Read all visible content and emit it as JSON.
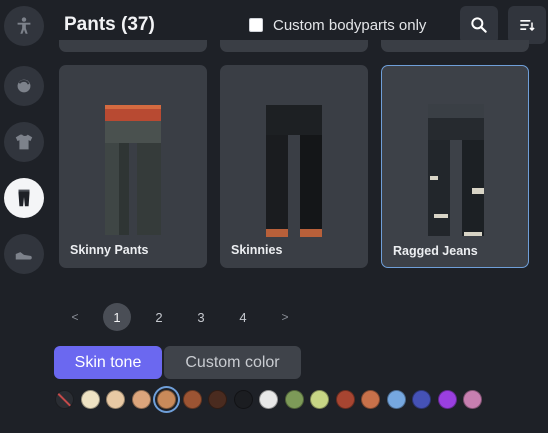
{
  "header": {
    "title": "Pants (37)",
    "custom_filter_label": "Custom bodyparts only",
    "custom_filter_checked": false
  },
  "sidebar": {
    "items": [
      {
        "name": "body",
        "icon": "body-icon"
      },
      {
        "name": "head",
        "icon": "head-icon"
      },
      {
        "name": "shirt",
        "icon": "shirt-icon"
      },
      {
        "name": "pants",
        "icon": "pants-icon",
        "active": true
      },
      {
        "name": "shoes",
        "icon": "shoe-icon"
      }
    ]
  },
  "items": [
    {
      "label": "Skinny Pants",
      "selected": false,
      "colors": {
        "leg": "#3f4645",
        "band": "#b84a32"
      }
    },
    {
      "label": "Skinnies",
      "selected": false,
      "colors": {
        "leg": "#1a1c1f",
        "cuff": "#b8603a"
      }
    },
    {
      "label": "Ragged Jeans",
      "selected": true,
      "colors": {
        "leg": "#22262b",
        "patch": "#d8d4c6"
      }
    }
  ],
  "pagination": {
    "prev": "<",
    "pages": [
      "1",
      "2",
      "3",
      "4"
    ],
    "current": "1",
    "next": ">"
  },
  "tone_tabs": {
    "skin": "Skin tone",
    "custom": "Custom color",
    "active": "skin"
  },
  "swatches": [
    "none",
    "#efe3c4",
    "#e8c9a4",
    "#dca57c",
    "#c98a5a",
    "#9c5433",
    "#4a2b1f",
    "#1b1d21",
    "#e8e8e8",
    "#7d9a58",
    "#c7d585",
    "#a74531",
    "#c8714a",
    "#76a8e0",
    "#4552b6",
    "#9a3fe0",
    "#c77fb0"
  ],
  "selected_swatch": 4,
  "colors": {
    "accent": "#6b68f0",
    "selection": "#6f9fd9",
    "background": "#1e2127",
    "card": "#3a3e45"
  }
}
